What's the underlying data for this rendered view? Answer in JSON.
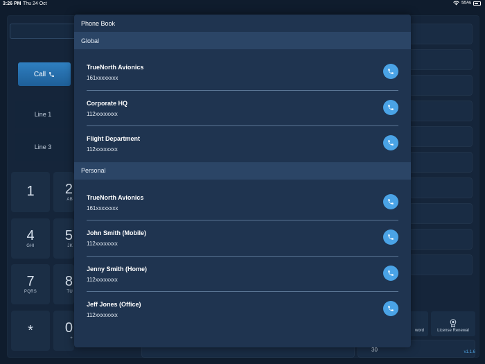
{
  "status_bar": {
    "time": "3:26 PM",
    "date": "Thu 24 Oct",
    "battery": "55%"
  },
  "background_app": {
    "call_label": "Call",
    "lines": [
      "Line 1",
      "Line 3"
    ],
    "keypad": [
      {
        "digit": "1",
        "letters": ""
      },
      {
        "digit": "2",
        "letters": "AB"
      },
      {
        "digit": "4",
        "letters": "GHI"
      },
      {
        "digit": "5",
        "letters": "JK"
      },
      {
        "digit": "7",
        "letters": "PQRS"
      },
      {
        "digit": "8",
        "letters": "TU"
      },
      {
        "digit": "*",
        "letters": ""
      },
      {
        "digit": "0",
        "letters": "+"
      }
    ],
    "bottom_tiles": [
      "word",
      "License Renewal"
    ],
    "bottom_value": "30",
    "version": "v1.1.6"
  },
  "phone_book": {
    "title": "Phone Book",
    "sections": [
      {
        "label": "Global",
        "contacts": [
          {
            "name": "TrueNorth Avionics",
            "number": "161xxxxxxxx"
          },
          {
            "name": "Corporate HQ",
            "number": "112xxxxxxxx"
          },
          {
            "name": "Flight Department",
            "number": "112xxxxxxxx"
          }
        ]
      },
      {
        "label": "Personal",
        "contacts": [
          {
            "name": "TrueNorth Avionics",
            "number": "161xxxxxxxx"
          },
          {
            "name": "John Smith (Mobile)",
            "number": "112xxxxxxxx"
          },
          {
            "name": "Jenny Smith (Home)",
            "number": "112xxxxxxxx"
          },
          {
            "name": "Jeff Jones (Office)",
            "number": "112xxxxxxxx"
          }
        ]
      }
    ]
  },
  "colors": {
    "accent": "#4aa3e6",
    "modal_bg": "#1f3450",
    "section_bg": "#2b4566",
    "app_bg": "#0f1c2d"
  }
}
